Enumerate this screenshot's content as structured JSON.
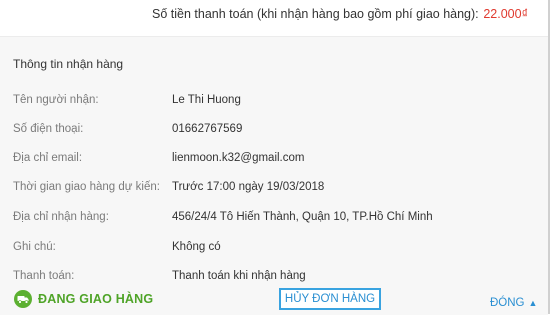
{
  "payment": {
    "label": "Số tiền thanh toán (khi nhận hàng bao gồm phí giao hàng):",
    "amount": "22.000₫"
  },
  "receiver_info": {
    "title": "Thông tin nhận hàng",
    "rows": [
      {
        "label": "Tên người nhận:",
        "value": "Le Thi Huong"
      },
      {
        "label": "Số điện thoại:",
        "value": "01662767569"
      },
      {
        "label": "Địa chỉ email:",
        "value": "lienmoon.k32@gmail.com"
      },
      {
        "label": "Thời gian giao hàng dự kiến:",
        "value": "Trước 17:00 ngày 19/03/2018"
      },
      {
        "label": "Địa chỉ nhận hàng:",
        "value": "456/24/4 Tô Hiến Thành, Quận 10, TP.Hồ Chí Minh"
      },
      {
        "label": "Ghi chú:",
        "value": "Không có"
      },
      {
        "label": "Thanh toán:",
        "value": "Thanh toán khi nhận hàng"
      }
    ]
  },
  "footer": {
    "status_text": "ĐANG GIAO HÀNG",
    "status_icon": "delivery-icon",
    "cancel_label": "HỦY ĐƠN HÀNG",
    "close_label": "ĐÓNG",
    "close_icon": "caret-up-icon"
  },
  "colors": {
    "amount": "#e03a2f",
    "status": "#4fa428",
    "accent": "#2a8fd2"
  }
}
